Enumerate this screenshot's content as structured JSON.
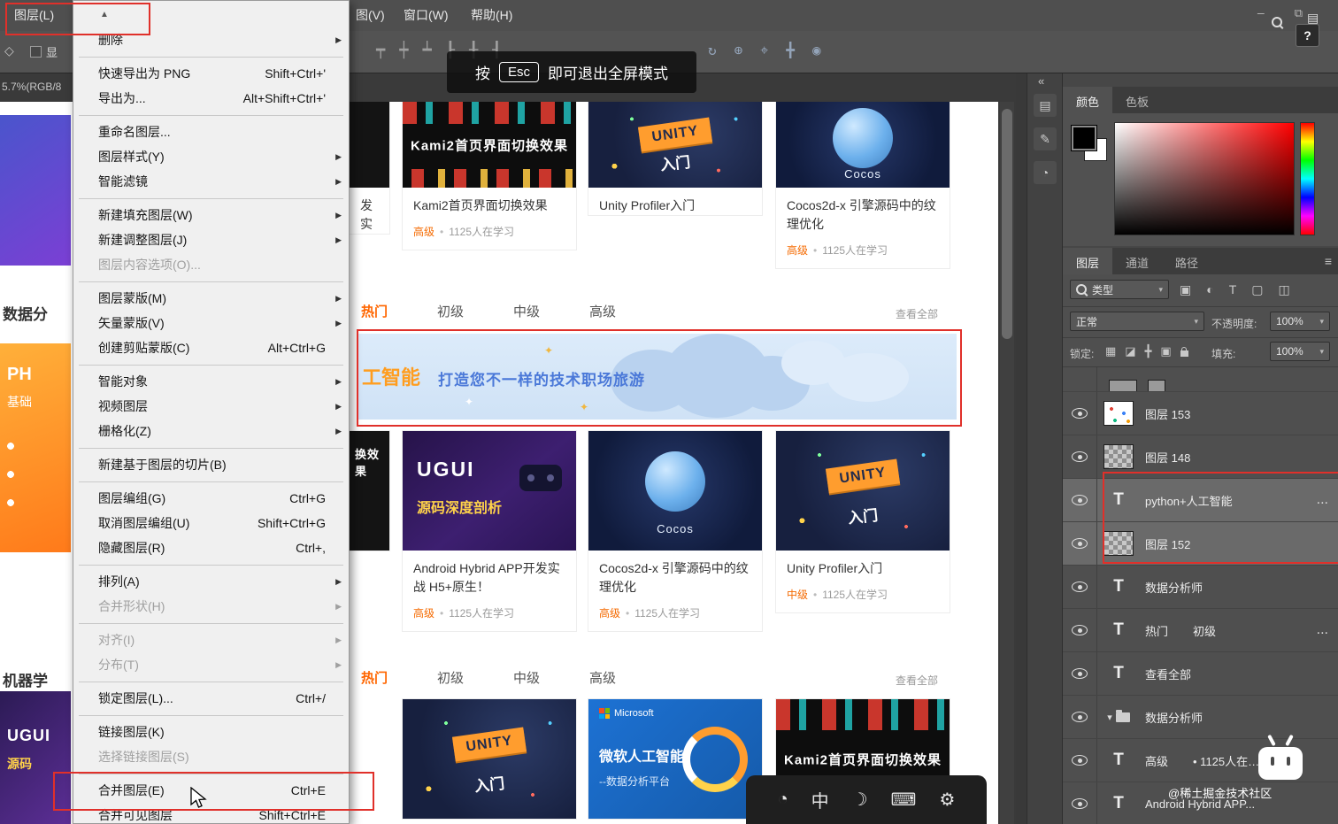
{
  "chrome": {
    "menubar_items": [
      "图层(L)",
      "图(V)",
      "窗口(W)",
      "帮助(H)"
    ],
    "window_controls": [
      {
        "name": "minimize-icon",
        "glyph": "—"
      },
      {
        "name": "restore-icon",
        "glyph": "⧉"
      }
    ],
    "help_label": "?",
    "panel_toggle_glyph": "▤",
    "esc_toast": {
      "prefix": "按",
      "key": "Esc",
      "suffix": "即可退出全屏模式"
    }
  },
  "options_bar": {
    "tool_icon_glyph": "◇",
    "show_checkbox_label": "显",
    "align_icons": [
      {
        "name": "align-top-icon",
        "glyph": "┯"
      },
      {
        "name": "align-vcenter-icon",
        "glyph": "┿"
      },
      {
        "name": "align-bottom-icon",
        "glyph": "┷"
      },
      {
        "name": "align-left-icon",
        "glyph": "┠"
      },
      {
        "name": "align-hcenter-icon",
        "glyph": "╂"
      },
      {
        "name": "align-right-icon",
        "glyph": "┨"
      }
    ],
    "view_icons": [
      {
        "name": "orbit-3d-icon",
        "glyph": "↻"
      },
      {
        "name": "roll-3d-icon",
        "glyph": "⊕"
      },
      {
        "name": "pan-3d-icon",
        "glyph": "⌖"
      },
      {
        "name": "slide-3d-icon",
        "glyph": "╋"
      },
      {
        "name": "camera-icon",
        "glyph": "◉"
      }
    ]
  },
  "layer_menu": {
    "scroll_up_glyph": "▲",
    "submenu_arrow_glyph": "▶",
    "items": [
      {
        "label": "删除",
        "submenu": true
      },
      {
        "sep": true
      },
      {
        "label": "快速导出为 PNG",
        "shortcut": "Shift+Ctrl+'"
      },
      {
        "label": "导出为...",
        "shortcut": "Alt+Shift+Ctrl+'"
      },
      {
        "sep": true
      },
      {
        "label": "重命名图层..."
      },
      {
        "label": "图层样式(Y)",
        "submenu": true
      },
      {
        "label": "智能滤镜",
        "submenu": true
      },
      {
        "sep": true
      },
      {
        "label": "新建填充图层(W)",
        "submenu": true
      },
      {
        "label": "新建调整图层(J)",
        "submenu": true
      },
      {
        "label": "图层内容选项(O)...",
        "disabled": true
      },
      {
        "sep": true
      },
      {
        "label": "图层蒙版(M)",
        "submenu": true
      },
      {
        "label": "矢量蒙版(V)",
        "submenu": true
      },
      {
        "label": "创建剪贴蒙版(C)",
        "shortcut": "Alt+Ctrl+G"
      },
      {
        "sep": true
      },
      {
        "label": "智能对象",
        "submenu": true
      },
      {
        "label": "视频图层",
        "submenu": true
      },
      {
        "label": "栅格化(Z)",
        "submenu": true
      },
      {
        "sep": true
      },
      {
        "label": "新建基于图层的切片(B)"
      },
      {
        "sep": true
      },
      {
        "label": "图层编组(G)",
        "shortcut": "Ctrl+G"
      },
      {
        "label": "取消图层编组(U)",
        "shortcut": "Shift+Ctrl+G"
      },
      {
        "label": "隐藏图层(R)",
        "shortcut": "Ctrl+,"
      },
      {
        "sep": true
      },
      {
        "label": "排列(A)",
        "submenu": true
      },
      {
        "label": "合并形状(H)",
        "submenu": true,
        "disabled": true
      },
      {
        "sep": true
      },
      {
        "label": "对齐(I)",
        "submenu": true,
        "disabled": true
      },
      {
        "label": "分布(T)",
        "submenu": true,
        "disabled": true
      },
      {
        "sep": true
      },
      {
        "label": "锁定图层(L)...",
        "shortcut": "Ctrl+/"
      },
      {
        "sep": true
      },
      {
        "label": "链接图层(K)"
      },
      {
        "label": "选择链接图层(S)",
        "disabled": true
      },
      {
        "sep": true
      },
      {
        "label": "合并图层(E)",
        "shortcut": "Ctrl+E",
        "annotated": true
      },
      {
        "label": "合并可见图层",
        "shortcut": "Shift+Ctrl+E"
      }
    ]
  },
  "canvas": {
    "doc_info": "5.7%(RGB/8",
    "left_slivers": {
      "label_top": "数据分",
      "orange_line1": "PH",
      "orange_line2": "基础",
      "label_bottom": "机器学",
      "purple_line1": "UGUI",
      "purple_line2": "源码"
    },
    "tabs": [
      "热门",
      "初级",
      "中级",
      "高级"
    ],
    "view_all": "查看全部",
    "banner": {
      "headline": "工智能",
      "tagline": "打造您不一样的技术职场旅游"
    },
    "rows": [
      {
        "cards": [
          {
            "style": "dark",
            "partial": true,
            "title": "发实"
          },
          {
            "style": "kami2",
            "thumb_label": "Kami2首页界面切换效果",
            "title": "Kami2首页界面切换效果",
            "level": "高级",
            "count": "1125人在学习"
          },
          {
            "style": "unity",
            "thumb_label": "UNITY",
            "thumb_sub": "入门",
            "title": "Unity Profiler入门"
          },
          {
            "style": "cocos",
            "thumb_label": "Cocos",
            "title": "Cocos2d-x 引擎源码中的纹理优化",
            "level": "高级",
            "count": "1125人在学习"
          }
        ]
      },
      {
        "cards": [
          {
            "style": "dark",
            "partial": true,
            "thumb_label": "换效果"
          },
          {
            "style": "ugui",
            "thumb_label": "UGUI",
            "thumb_sub": "源码深度剖析",
            "title": "Android Hybrid APP开发实战 H5+原生！",
            "level": "高级",
            "count": "1125人在学习"
          },
          {
            "style": "cocos",
            "thumb_label": "Cocos",
            "title": "Cocos2d-x 引擎源码中的纹理优化",
            "level": "高级",
            "count": "1125人在学习"
          },
          {
            "style": "unity",
            "thumb_label": "UNITY",
            "thumb_sub": "入门",
            "title": "Unity Profiler入门",
            "level": "中级",
            "count": "1125人在学习"
          }
        ]
      },
      {
        "cards": [
          {
            "style": "unity",
            "thumb_label": "UNITY",
            "thumb_sub": "入门"
          },
          {
            "style": "ms",
            "thumb_brand": "Microsoft",
            "thumb_label": "微软人工智能",
            "thumb_sub": "--数据分析平台"
          },
          {
            "style": "kami2",
            "thumb_label": "Kami2首页界面切换效果"
          }
        ]
      }
    ]
  },
  "panels": {
    "caret_glyph": "▾",
    "collapse_arrow": "«",
    "collapsed_icons": [
      {
        "name": "history-panel-icon",
        "glyph": "▤"
      },
      {
        "name": "properties-panel-icon",
        "glyph": "✎"
      },
      {
        "name": "info-panel-icon",
        "glyph": "◔"
      }
    ],
    "color": {
      "tabs": [
        "颜色",
        "色板"
      ]
    },
    "layers": {
      "tabs": [
        "图层",
        "通道",
        "路径"
      ],
      "menu_glyph": "≡",
      "kind_label": "类型",
      "filter_icons": [
        {
          "name": "pixel-filter-icon",
          "glyph": "▣"
        },
        {
          "name": "adjustment-filter-icon",
          "glyph": "◐"
        },
        {
          "name": "type-filter-icon",
          "glyph": "T"
        },
        {
          "name": "shape-filter-icon",
          "glyph": "▢"
        },
        {
          "name": "smart-object-filter-icon",
          "glyph": "◫"
        }
      ],
      "blend_mode": "正常",
      "opacity_label": "不透明度:",
      "opacity_value": "100%",
      "lock_label": "锁定:",
      "lock_icons": [
        {
          "name": "lock-transparency-icon",
          "glyph": "▦"
        },
        {
          "name": "lock-pixels-icon",
          "glyph": "◪"
        },
        {
          "name": "lock-position-icon",
          "glyph": "╋"
        },
        {
          "name": "lock-artboard-icon",
          "glyph": "▣"
        }
      ],
      "fill_label": "填充:",
      "fill_value": "100%",
      "rows": [
        {
          "thumb": "dots",
          "name": "图层 153"
        },
        {
          "thumb": "checker",
          "name": "图层 148"
        },
        {
          "thumb": "text",
          "name": "python+人工智能",
          "trailing": "...",
          "selected": true
        },
        {
          "thumb": "checker",
          "name": "图层 152",
          "selected": true
        },
        {
          "thumb": "text",
          "name": "数据分析师"
        },
        {
          "thumb": "text",
          "name": "热门",
          "extra": "初级",
          "trailing": "..."
        },
        {
          "thumb": "text",
          "name": "查看全部"
        },
        {
          "thumb": "group",
          "name": "数据分析师"
        },
        {
          "thumb": "text",
          "name": "高级",
          "extra": "•  1125人在…"
        },
        {
          "thumb": "text",
          "name": "Android Hybrid APP..."
        }
      ]
    }
  },
  "watermark": {
    "handle": "@稀土掘金技术社区"
  },
  "ime_bar": {
    "icons": [
      {
        "name": "language-wheel-icon",
        "glyph": "◔"
      },
      {
        "name": "chinese-input-icon",
        "glyph": "中"
      },
      {
        "name": "punctuation-icon",
        "glyph": "☽"
      },
      {
        "name": "keyboard-icon",
        "glyph": "⌨"
      },
      {
        "name": "settings-gear-icon",
        "glyph": "⚙"
      }
    ]
  }
}
